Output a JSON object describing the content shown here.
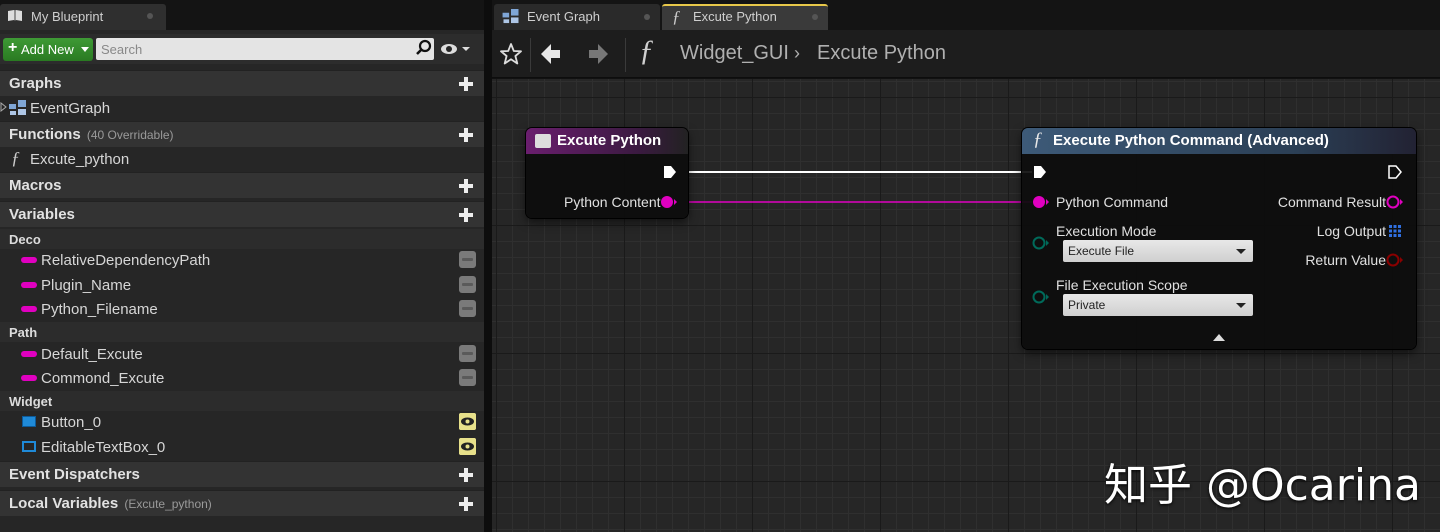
{
  "left_panel": {
    "tab_title": "My Blueprint",
    "add_new_label": "Add New",
    "search_placeholder": "Search",
    "sections": {
      "graphs": {
        "title": "Graphs",
        "items": [
          "EventGraph"
        ]
      },
      "functions": {
        "title": "Functions",
        "subtitle": "(40 Overridable)",
        "items": [
          "Excute_python"
        ]
      },
      "macros": {
        "title": "Macros"
      },
      "variables": {
        "title": "Variables",
        "categories": [
          {
            "name": "Deco",
            "items": [
              "RelativeDependencyPath",
              "Plugin_Name",
              "Python_Filename"
            ]
          },
          {
            "name": "Path",
            "items": [
              "Default_Excute",
              "Commond_Excute"
            ]
          },
          {
            "name": "Widget",
            "items": [
              "Button_0",
              "EditableTextBox_0"
            ]
          }
        ]
      },
      "event_dispatchers": {
        "title": "Event Dispatchers"
      },
      "local_variables": {
        "title": "Local Variables",
        "subtitle": "(Excute_python)"
      }
    }
  },
  "editor": {
    "tabs": [
      "Event Graph",
      "Excute Python"
    ],
    "active_tab": "Excute Python",
    "breadcrumb": [
      "Widget_GUI",
      "Excute Python"
    ],
    "nodes": {
      "entry": {
        "title": "Excute Python",
        "output_pin": "Python Content"
      },
      "command": {
        "title": "Execute Python Command (Advanced)",
        "input_pins": [
          "Python Command",
          "Execution Mode",
          "File Execution Scope"
        ],
        "output_pins": [
          "Command Result",
          "Log Output",
          "Return Value"
        ],
        "execution_mode_value": "Execute File",
        "file_execution_scope_value": "Private"
      }
    },
    "watermark": "知乎 @Ocarina"
  },
  "colors": {
    "string_pin": "#e000c0",
    "bool_pin": "#8a0000",
    "enum_pin": "#006a5a",
    "array_pin": "#2f6fe0",
    "function_header": "#3d5a78",
    "entry_header": "#6a1e6e",
    "add_new_green": "#2f8a27",
    "active_tab_accent": "#e8c84a"
  }
}
